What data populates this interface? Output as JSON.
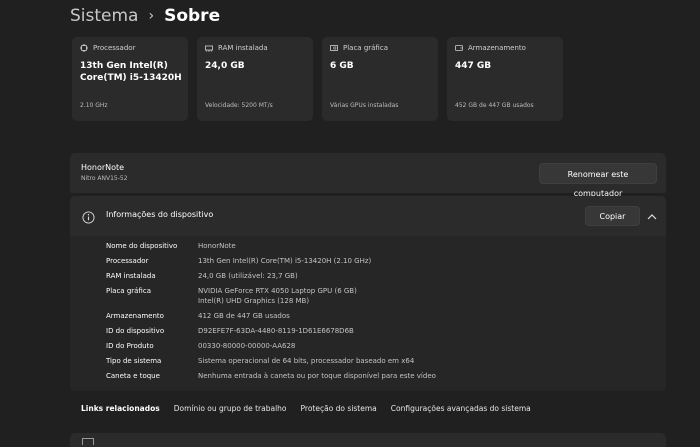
{
  "breadcrumb": {
    "parent": "Sistema",
    "separator": "›",
    "current": "Sobre"
  },
  "cards": [
    {
      "icon": "processor-icon",
      "label": "Processador",
      "value": "13th Gen Intel(R) Core(TM) i5-13420H",
      "sub": "2.10 GHz"
    },
    {
      "icon": "ram-icon",
      "label": "RAM instalada",
      "value": "24,0 GB",
      "sub": "Velocidade: 5200 MT/s"
    },
    {
      "icon": "gpu-icon",
      "label": "Placa gráfica",
      "value": "6 GB",
      "sub": "Várias GPUs instaladas"
    },
    {
      "icon": "storage-icon",
      "label": "Armazenamento",
      "value": "447 GB",
      "sub": "452 GB de 447 GB usados"
    }
  ],
  "device": {
    "name": "HonorNote",
    "model": "Nitro ANV15-52",
    "rename_label": "Renomear este computador"
  },
  "info": {
    "title": "Informações do dispositivo",
    "copy_label": "Copiar",
    "rows": [
      {
        "label": "Nome do dispositivo",
        "value": "HonorNote"
      },
      {
        "label": "Processador",
        "value": "13th Gen Intel(R) Core(TM) i5-13420H (2.10 GHz)"
      },
      {
        "label": "RAM instalada",
        "value": "24,0 GB (utilizável: 23,7 GB)"
      },
      {
        "label": "Placa gráfica",
        "value": "NVIDIA GeForce RTX 4050 Laptop GPU (6 GB)",
        "value2": "Intel(R) UHD Graphics (128 MB)"
      },
      {
        "label": "Armazenamento",
        "value": "412 GB de 447 GB usados"
      },
      {
        "label": "ID do dispositivo",
        "value": "D92EFE7F-63DA-4480-8119-1D61E6678D6B"
      },
      {
        "label": "ID do Produto",
        "value": "00330-80000-00000-AA628"
      },
      {
        "label": "Tipo de sistema",
        "value": "Sistema operacional de 64 bits, processador baseado em x64"
      },
      {
        "label": "Caneta e toque",
        "value": "Nenhuma entrada à caneta ou por toque disponível para este vídeo"
      }
    ]
  },
  "links": {
    "title": "Links relacionados",
    "items": [
      "Domínio ou grupo de trabalho",
      "Proteção do sistema",
      "Configurações avançadas do sistema"
    ]
  }
}
